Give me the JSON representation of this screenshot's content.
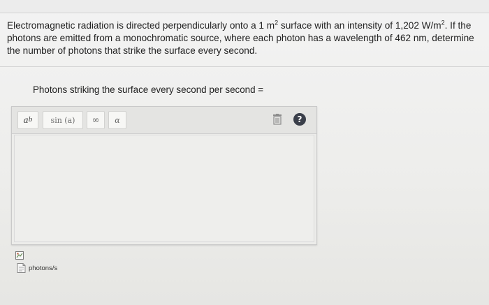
{
  "question": {
    "text_a": "Electromagnetic radiation is directed perpendicularly onto a 1 m",
    "sup_a": "2",
    "text_b": " surface with an intensity of 1,202 W/m",
    "sup_b": "2",
    "text_c": ". If the photons are emitted from a monochromatic source, where each photon has a wavelength of 462 nm, determine the number of photons that strike the surface every second."
  },
  "answer": {
    "prompt": "Photons striking the surface every second per second =",
    "value": "",
    "unit": "photons/s"
  },
  "toolbar": {
    "exponent_base": "a",
    "exponent_power": "b",
    "sin_label": "sin (a)",
    "infinity_label": "∞",
    "alpha_label": "α",
    "help_label": "?"
  },
  "icons": {
    "trash": "trash-icon",
    "help": "help-icon",
    "broken_image": "broken-image-icon",
    "unit_file": "file-icon"
  },
  "colors": {
    "help_bg": "#3a3f4a",
    "background": "#f0f0ee"
  }
}
